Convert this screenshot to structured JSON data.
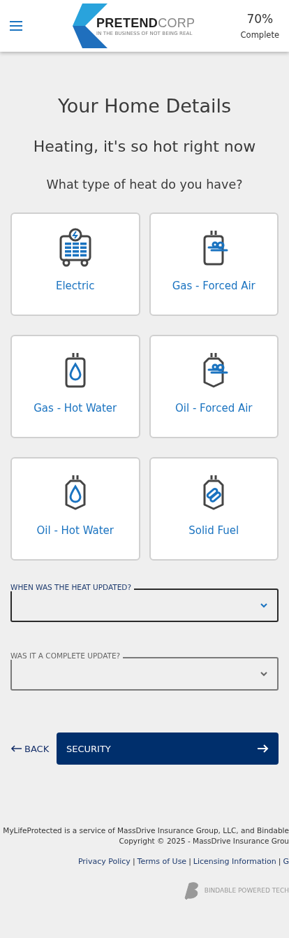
{
  "header": {
    "brand_bold": "PRETEND",
    "brand_light": "CORP",
    "tagline": "IN THE BUSINESS OF NOT BEING REAL",
    "progress_value": "70%",
    "progress_label": "Complete"
  },
  "title": "Your Home Details",
  "subtitle": "Heating, it's so hot right now",
  "question": "What type of heat do you have?",
  "options": [
    {
      "kind": "electric",
      "label": "Electric",
      "selected": false
    },
    {
      "kind": "gas-air",
      "label": "Gas - Forced Air",
      "selected": false
    },
    {
      "kind": "gas-water",
      "label": "Gas - Hot Water",
      "selected": false
    },
    {
      "kind": "oil-air",
      "label": "Oil - Forced Air",
      "selected": false
    },
    {
      "kind": "oil-water",
      "label": "Oil - Hot Water",
      "selected": false
    },
    {
      "kind": "solid",
      "label": "Solid Fuel",
      "selected": false
    }
  ],
  "selects": [
    {
      "label": "WHEN WAS THE HEAT UPDATED?",
      "focused": true
    },
    {
      "label": "WAS IT A COMPLETE UPDATE?",
      "focused": false
    }
  ],
  "back": {
    "label": "BACK"
  },
  "next": {
    "label": "SECURITY"
  },
  "footer": {
    "lines": [
      "MyLifeProtected is a service of MassDrive Insurance Group, LLC, and Bindable",
      "Copyright © 2025 - MassDrive Insurance Grou"
    ],
    "links": [
      "Privacy Policy",
      "Terms of Use",
      "Licensing Information",
      "G"
    ],
    "separator": "|",
    "powered": "BINDABLE POWERED TECH"
  }
}
